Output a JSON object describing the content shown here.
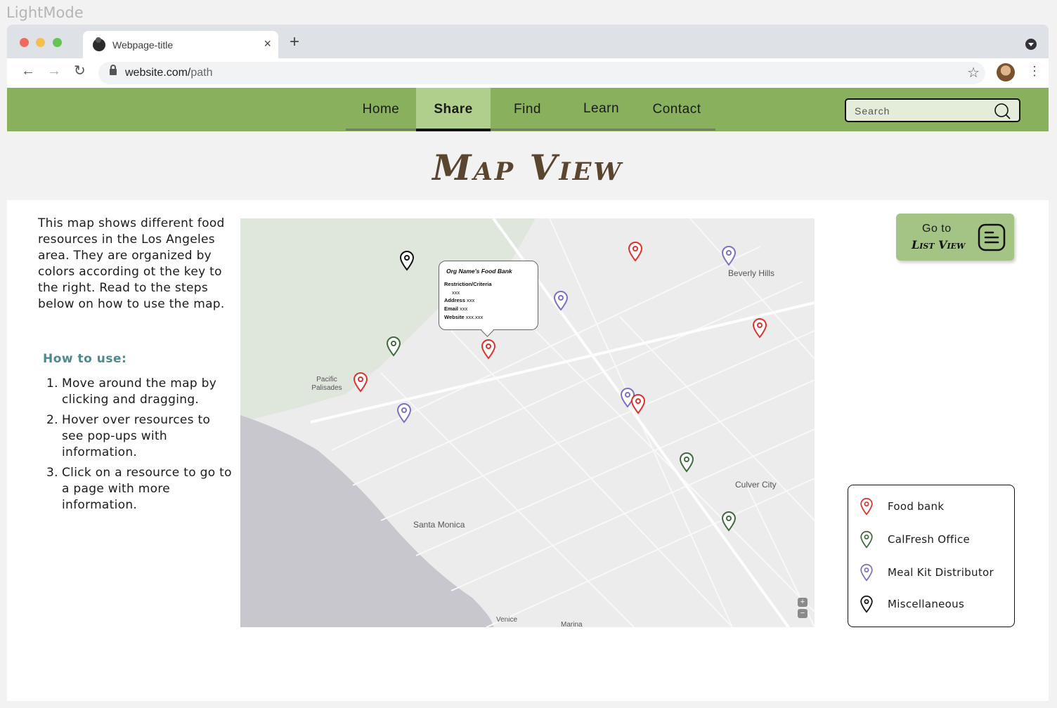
{
  "frame_label": "LightMode",
  "browser": {
    "tab_title": "Webpage-title",
    "tab_close": "×",
    "new_tab": "+",
    "url_host": "website.com/",
    "url_path": "path"
  },
  "nav": {
    "items": [
      {
        "label": "Home",
        "active": false
      },
      {
        "label": "Share",
        "active": true
      },
      {
        "label": "Find",
        "active": false
      },
      {
        "label": "Learn",
        "active": false
      },
      {
        "label": "Contact",
        "active": false
      }
    ],
    "search_placeholder": "Search"
  },
  "page_title": "Map View",
  "intro": "This map shows different food resources in the Los Angeles area. They are organized by colors according ot the key to the right. Read to the steps below on how to use the map.",
  "howto_heading": "How to use:",
  "steps": [
    "Move around the map by clicking and dragging.",
    "Hover over resources to see pop-ups with information.",
    "Click on a resource to go to a page with more information."
  ],
  "map": {
    "labels": [
      "Beverly Hills",
      "Pacific Palisades",
      "Santa Monica",
      "Culver City",
      "Venice",
      "Marina"
    ],
    "zoom_in": "+",
    "zoom_out": "−",
    "popup": {
      "title": "Org Name's Food Bank",
      "criteria_label": "Restriction/Criteria",
      "criteria_value": "xxx",
      "address_label": "Address",
      "address_value": "xxx",
      "email_label": "Email",
      "email_value": "xxx",
      "website_label": "Website",
      "website_value": "xxx.xxx"
    }
  },
  "list_view_button": {
    "line1": "Go to",
    "line2": "List View"
  },
  "legend": [
    {
      "label": "Food bank",
      "color": "#e0302a"
    },
    {
      "label": "CalFresh Office",
      "color": "#3d6b3d"
    },
    {
      "label": "Meal Kit Distributor",
      "color": "#7b6fc7"
    },
    {
      "label": "Miscellaneous",
      "color": "#111111"
    }
  ]
}
